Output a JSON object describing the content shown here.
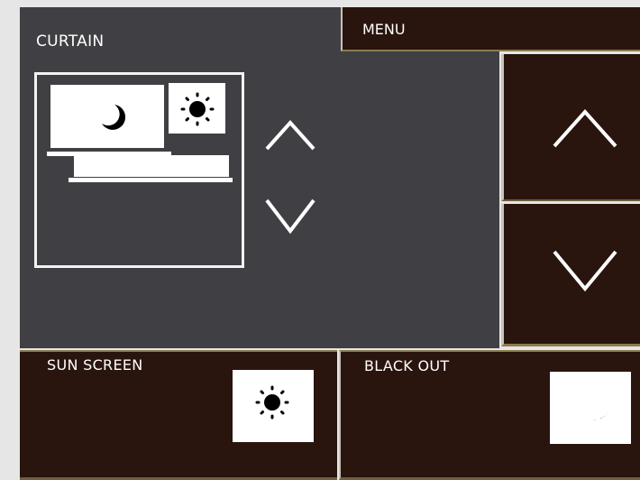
{
  "panel": {
    "title": "CURTAIN"
  },
  "menu": {
    "label": "MENU"
  },
  "buttons": {
    "sun_screen": "SUN SCREEN",
    "black_out": "BLACK OUT"
  },
  "icons": {
    "up": "chevron-up-icon",
    "down": "chevron-down-icon",
    "sun": "sun-icon",
    "moon": "moon-icon"
  },
  "colors": {
    "panel_background": "#404044",
    "button_background": "#2a140e",
    "accent_border": "#8a7c4e",
    "page_background": "#e6e6e6"
  }
}
